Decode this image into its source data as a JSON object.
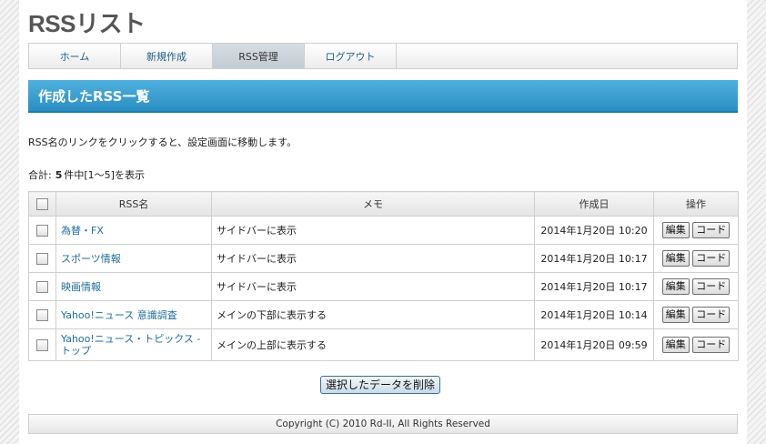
{
  "site_title": "RSSリスト",
  "nav": [
    {
      "label": "ホーム",
      "active": false
    },
    {
      "label": "新規作成",
      "active": false
    },
    {
      "label": "RSS管理",
      "active": true
    },
    {
      "label": "ログアウト",
      "active": false
    }
  ],
  "section_title": "作成したRSS一覧",
  "description": "RSS名のリンクをクリックすると、設定画面に移動します。",
  "summary": {
    "label": "合計:",
    "count": "5",
    "suffix": "件中[1～5]を表示"
  },
  "table": {
    "headers": {
      "name": "RSS名",
      "memo": "メモ",
      "created": "作成日",
      "actions": "操作"
    },
    "rows": [
      {
        "name": "為替・FX",
        "memo": "サイドバーに表示",
        "date": "2014年1月20日 10:20"
      },
      {
        "name": "スポーツ情報",
        "memo": "サイドバーに表示",
        "date": "2014年1月20日 10:17"
      },
      {
        "name": "映画情報",
        "memo": "サイドバーに表示",
        "date": "2014年1月20日 10:17"
      },
      {
        "name": "Yahoo!ニュース 意識調査",
        "memo": "メインの下部に表示する",
        "date": "2014年1月20日 10:14"
      },
      {
        "name": "Yahoo!ニュース・トピックス - トップ",
        "memo": "メインの上部に表示する",
        "date": "2014年1月20日 09:59"
      }
    ],
    "edit_label": "編集",
    "code_label": "コード"
  },
  "delete_button": "選択したデータを削除",
  "footer": "Copyright (C) 2010 Rd-II, All Rights Reserved",
  "colors": {
    "section_bar": "#2a8fc4",
    "link": "#1f6e9c"
  }
}
